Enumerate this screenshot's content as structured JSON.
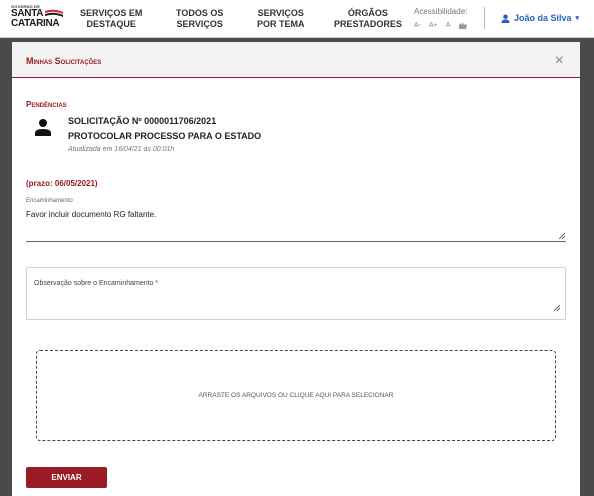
{
  "header": {
    "logo": {
      "small": "GOVERNO DE",
      "line1": "SANTA",
      "line2": "CATARINA"
    },
    "nav": [
      {
        "line1": "SERVIÇOS EM",
        "line2": "DESTAQUE"
      },
      {
        "line1": "TODOS OS",
        "line2": "SERVIÇOS"
      },
      {
        "line1": "SERVIÇOS",
        "line2": "POR TEMA"
      },
      {
        "line1": "ÓRGÃOS",
        "line2": "PRESTADORES"
      }
    ],
    "accessibility": {
      "label": "Acessibilidade:",
      "decrease": "A-",
      "increase": "A+",
      "normal": "A"
    },
    "user": {
      "name": "João da Silva",
      "caret": "▾"
    }
  },
  "modal": {
    "title": "Minhas Solicitações",
    "close": "×",
    "section": "Pendências",
    "request": {
      "title": "SOLICITAÇÃO Nº 0000011706/2021",
      "subject": "PROTOCOLAR PROCESSO PARA O ESTADO",
      "updated": "Atualizada em 16/04/21 às 00:01h"
    },
    "deadline": "(prazo: 06/05/2021)",
    "forwarding": {
      "label": "Encaminhamento",
      "value": "Favor incluir documento RG faltante."
    },
    "observation": {
      "label": "Observação sobre o Encaminhamento *",
      "value": ""
    },
    "dropzone": "Arraste os arquivos ou clique aqui para selecionar",
    "submit": "ENVIAR"
  },
  "colors": {
    "accent": "#9a1b24",
    "link": "#2b5fbf",
    "backdrop": "#4a4a4a"
  }
}
